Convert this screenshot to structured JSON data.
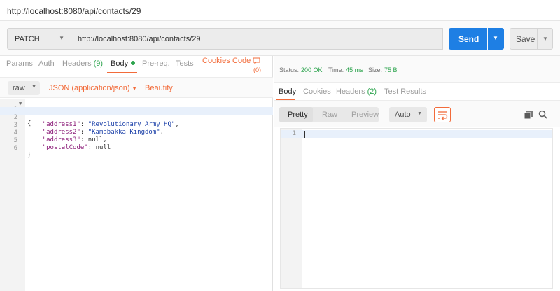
{
  "window": {
    "title": "http://localhost:8080/api/contacts/29"
  },
  "request": {
    "method": "PATCH",
    "url": "http://localhost:8080/api/contacts/29",
    "send_label": "Send",
    "save_label": "Save"
  },
  "request_tabs": {
    "params": "Params",
    "auth": "Auth",
    "headers": "Headers",
    "headers_count": "(9)",
    "body": "Body",
    "prereq": "Pre-req.",
    "tests": "Tests",
    "cookies": "Cookies",
    "code": "Code",
    "comments_count": "(0)"
  },
  "body_options": {
    "mode": "raw",
    "content_type": "JSON (application/json)",
    "beautify": "Beautify"
  },
  "request_body": {
    "lines": [
      {
        "num": "1",
        "text": "{"
      },
      {
        "num": "2",
        "key": "\"address1\"",
        "value": "\"Revolutionary Army HQ\"",
        "suffix": ","
      },
      {
        "num": "3",
        "key": "\"address2\"",
        "value": "\"Kamabakka Kingdom\"",
        "suffix": ","
      },
      {
        "num": "4",
        "key": "\"address3\"",
        "value": "null",
        "suffix": ","
      },
      {
        "num": "5",
        "key": "\"postalCode\"",
        "value": "null",
        "suffix": ""
      },
      {
        "num": "6",
        "text": "}"
      }
    ]
  },
  "response": {
    "status_label": "Status:",
    "status_value": "200 OK",
    "time_label": "Time:",
    "time_value": "45 ms",
    "size_label": "Size:",
    "size_value": "75 B",
    "tabs": {
      "body": "Body",
      "cookies": "Cookies",
      "headers": "Headers",
      "headers_count": "(2)",
      "test_results": "Test Results"
    },
    "view_modes": {
      "pretty": "Pretty",
      "raw": "Raw",
      "preview": "Preview"
    },
    "format": "Auto",
    "line_number": "1"
  },
  "icons": {
    "wrap": "wrap-lines-icon",
    "copy": "copy-icon",
    "search": "search-icon"
  },
  "colors": {
    "accent": "#f26b3a",
    "send": "#1e7fe4",
    "success": "#2da44e"
  }
}
